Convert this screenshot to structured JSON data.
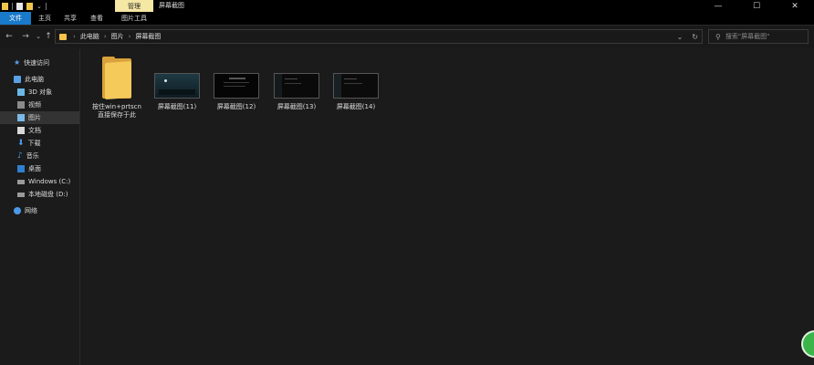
{
  "window": {
    "context_tab_label": "管理",
    "title": "屏幕截图",
    "controls": [
      "—",
      "☐",
      "✕"
    ]
  },
  "ribbon": {
    "tabs": [
      "文件",
      "主页",
      "共享",
      "查看",
      "图片工具"
    ]
  },
  "address": {
    "back": "←",
    "forward": "→",
    "recent": "⌄",
    "up": "↑",
    "breadcrumb": [
      "此电脑",
      "图片",
      "屏幕截图"
    ],
    "separator": "›",
    "dropdown": "⌄",
    "refresh": "↻"
  },
  "search": {
    "placeholder": "搜索\"屏幕截图\""
  },
  "sidebar": {
    "items": [
      {
        "label": "快速访问",
        "icon": "star-icon"
      },
      {
        "label": "此电脑",
        "icon": "computer-icon"
      },
      {
        "label": "3D 对象",
        "icon": "cube-icon"
      },
      {
        "label": "视频",
        "icon": "video-icon"
      },
      {
        "label": "图片",
        "icon": "pictures-icon",
        "selected": true
      },
      {
        "label": "文档",
        "icon": "document-icon"
      },
      {
        "label": "下载",
        "icon": "download-icon"
      },
      {
        "label": "音乐",
        "icon": "music-icon"
      },
      {
        "label": "桌面",
        "icon": "desktop-icon"
      },
      {
        "label": "Windows (C:)",
        "icon": "drive-icon"
      },
      {
        "label": "本地磁盘 (D:)",
        "icon": "drive-icon"
      },
      {
        "label": "网络",
        "icon": "network-icon"
      }
    ]
  },
  "files": [
    {
      "name_line1": "按住win+prtscn",
      "name_line2": "直接保存于此",
      "type": "folder"
    },
    {
      "name_line1": "屏幕截图(11)",
      "name_line2": "",
      "type": "image"
    },
    {
      "name_line1": "屏幕截图(12)",
      "name_line2": "",
      "type": "image"
    },
    {
      "name_line1": "屏幕截图(13)",
      "name_line2": "",
      "type": "image"
    },
    {
      "name_line1": "屏幕截图(14)",
      "name_line2": "",
      "type": "image"
    }
  ],
  "colors": {
    "file_tab": "#1979ca",
    "context_tab": "#f5e7a4",
    "folder": "#f5c95a",
    "fab": "#3bb54a"
  }
}
